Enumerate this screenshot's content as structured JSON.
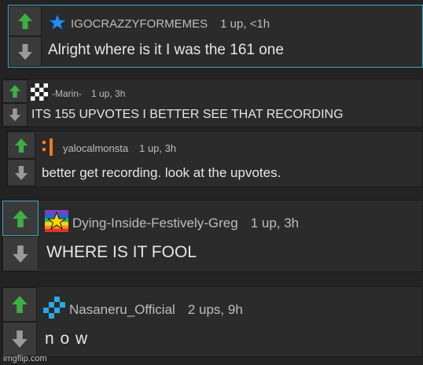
{
  "comments": [
    {
      "username": "IGOCRAZZYFORMEMES",
      "points": "1 up, <1h",
      "text": "Alright where is it I was the 161 one"
    },
    {
      "username": "-Marin-",
      "points": "1 up, 3h",
      "text": "ITS 155 UPVOTES I BETTER SEE THAT RECORDING"
    },
    {
      "username": "yalocalmonsta",
      "points": "1 up, 3h",
      "text": "better get recording. look at the upvotes."
    },
    {
      "username": "Dying-Inside-Festively-Greg",
      "points": "1 up, 3h",
      "text": "WHERE IS IT FOOL"
    },
    {
      "username": "Nasaneru_Official",
      "points": "2 ups, 9h",
      "text": "n o w"
    }
  ],
  "watermark": "imgflip.com",
  "colors": {
    "upvote": "#3cb043",
    "downvote": "#9a9a9a",
    "highlight": "#3fa7c8",
    "background": "#232323",
    "card": "#2b2b2b"
  }
}
